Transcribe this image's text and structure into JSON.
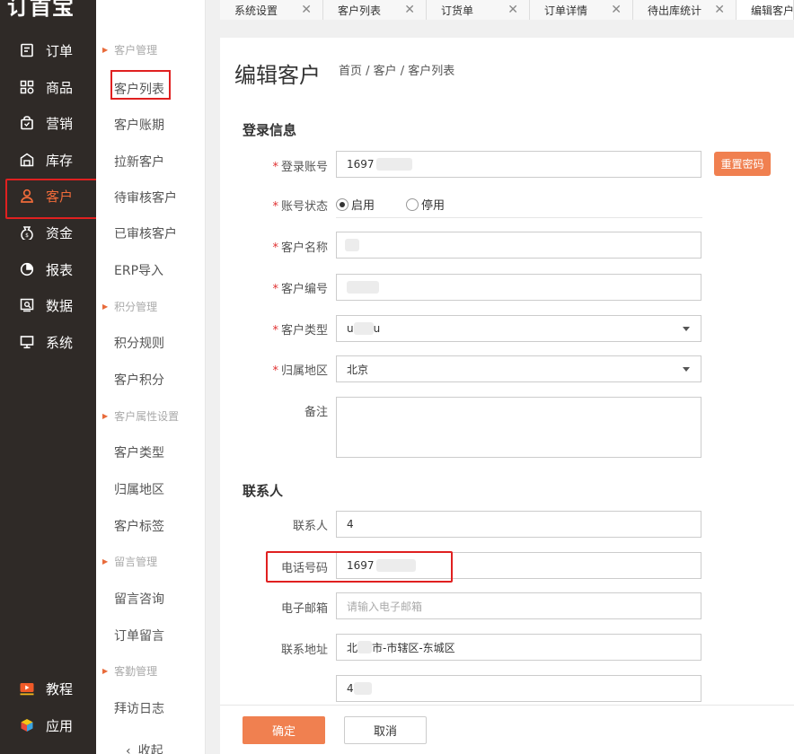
{
  "app": {
    "logo": "订首宝"
  },
  "nav": {
    "items": [
      {
        "label": "订单",
        "icon": "order-icon"
      },
      {
        "label": "商品",
        "icon": "grid-icon"
      },
      {
        "label": "营销",
        "icon": "bag-icon"
      },
      {
        "label": "库存",
        "icon": "warehouse-icon"
      },
      {
        "label": "客户",
        "icon": "user-icon",
        "active": true
      },
      {
        "label": "资金",
        "icon": "money-bag-icon"
      },
      {
        "label": "报表",
        "icon": "pie-chart-icon"
      },
      {
        "label": "数据",
        "icon": "data-search-icon"
      },
      {
        "label": "系统",
        "icon": "monitor-icon"
      }
    ],
    "bottom": [
      {
        "label": "教程",
        "icon": "play-icon"
      },
      {
        "label": "应用",
        "icon": "cube-icon"
      }
    ]
  },
  "subnav": {
    "sections": [
      {
        "title": "客户管理",
        "items": [
          "客户列表",
          "客户账期",
          "拉新客户",
          "待审核客户",
          "已审核客户",
          "ERP导入"
        ]
      },
      {
        "title": "积分管理",
        "items": [
          "积分规则",
          "客户积分"
        ]
      },
      {
        "title": "客户属性设置",
        "items": [
          "客户类型",
          "归属地区",
          "客户标签"
        ]
      },
      {
        "title": "留言管理",
        "items": [
          "留言咨询",
          "订单留言"
        ]
      },
      {
        "title": "客勤管理",
        "items": [
          "拜访日志"
        ]
      }
    ],
    "collapse_label": "收起"
  },
  "tabs": [
    {
      "label": "系统设置"
    },
    {
      "label": "客户列表"
    },
    {
      "label": "订货单"
    },
    {
      "label": "订单详情"
    },
    {
      "label": "待出库统计"
    },
    {
      "label": "编辑客户",
      "active": true
    }
  ],
  "page": {
    "title": "编辑客户",
    "breadcrumb": "首页 / 客户 / 客户列表"
  },
  "login_section": {
    "title": "登录信息",
    "account_label": "登录账号",
    "account_value": "1697",
    "reset_button": "重置密码",
    "status_label": "账号状态",
    "status_enabled": "启用",
    "status_disabled": "停用",
    "name_label": "客户名称",
    "code_label": "客户编号",
    "type_label": "客户类型",
    "type_value": "u",
    "type_value_end": "u",
    "region_label": "归属地区",
    "region_value": "北京",
    "remark_label": "备注"
  },
  "contact_section": {
    "title": "联系人",
    "contact_label": "联系人",
    "contact_value": "4",
    "phone_label": "电话号码",
    "phone_value": "1697",
    "email_label": "电子邮箱",
    "email_placeholder": "请输入电子邮箱",
    "address_label": "联系地址",
    "address_prefix": "北",
    "address_value": "市-市辖区-东城区",
    "address_detail": "4"
  },
  "footer": {
    "confirm": "确定",
    "cancel": "取消"
  },
  "colors": {
    "accent": "#f08050",
    "nav_bg": "#2f2a27",
    "highlight": "#e02020"
  }
}
